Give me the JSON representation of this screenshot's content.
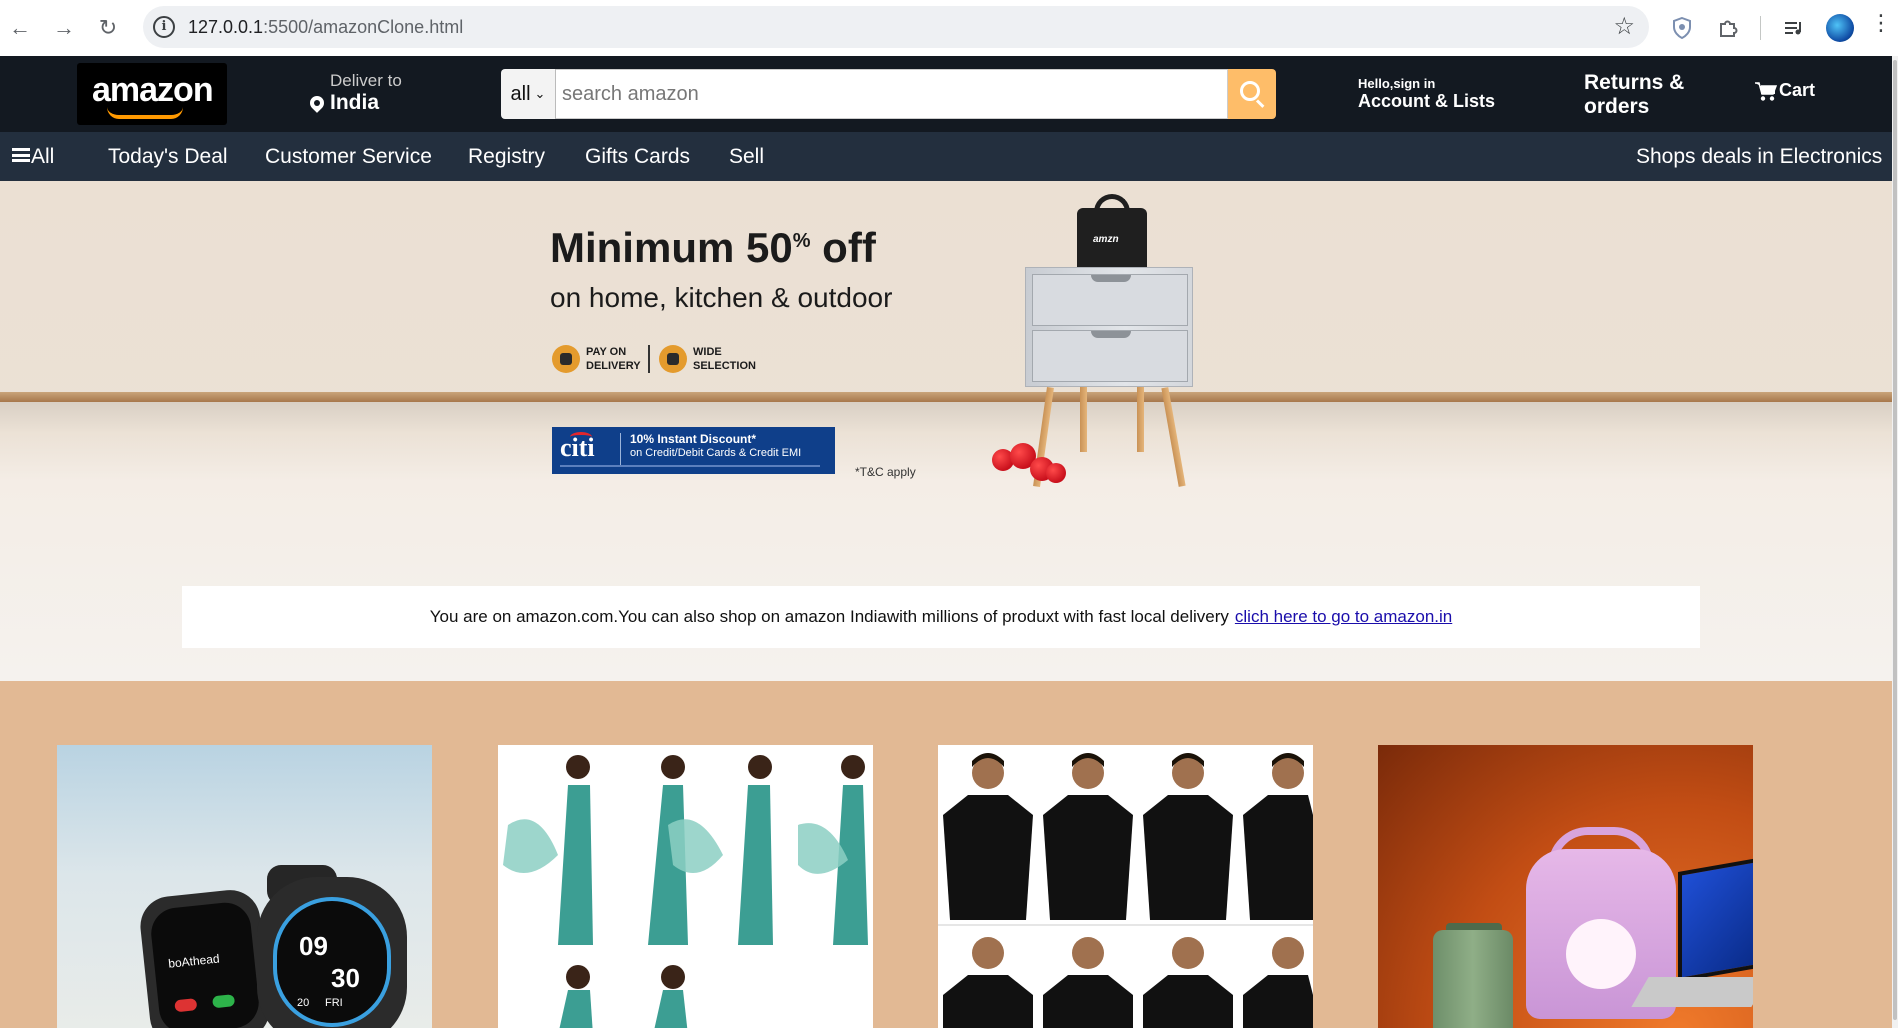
{
  "browser": {
    "url_host": "127.0.0.1",
    "url_rest": ":5500/amazonClone.html",
    "icons": [
      "back-icon",
      "forward-icon",
      "reload-icon",
      "site-info-icon",
      "bookmark-star-icon",
      "shield-extension-icon",
      "extensions-puzzle-icon",
      "media-control-icon",
      "profile-avatar-icon",
      "more-menu-icon"
    ]
  },
  "header": {
    "logo_text": "amazon",
    "deliver_label": "Deliver to",
    "deliver_location": "India",
    "search_category": "all",
    "search_placeholder": "search amazon",
    "account_hello": "Hello,sign in",
    "account_lists": "Account & Lists",
    "returns_line1": "Returns &",
    "returns_line2": "orders",
    "cart_label": "Cart",
    "colors": {
      "nav_bg": "#131921",
      "subnav_bg": "#232f3e",
      "search_button": "#febd69"
    }
  },
  "subnav": {
    "all_label": "All",
    "items": [
      "Today's Deal",
      "Customer Service",
      "Registry",
      "Gifts Cards",
      "Sell"
    ],
    "right_label": "Shops deals in Electronics"
  },
  "hero": {
    "title": "Minimum 50",
    "title_sup": "%",
    "title_suffix": " off",
    "subtitle": "on home, kitchen & outdoor",
    "badge1_line1": "PAY ON",
    "badge1_line2": "DELIVERY",
    "badge2_line1": "WIDE",
    "badge2_line2": "SELECTION",
    "citi_logo": "citi",
    "citi_line1": "10% Instant Discount*",
    "citi_line2": "on Credit/Debit Cards & Credit EMI",
    "tc": "*T&C apply",
    "bag_logo": "amzn"
  },
  "notice": {
    "text": "You are on amazon.com.You can also shop on amazon Indiawith millions of produxt with fast local delivery",
    "link": "clich here to go to amazon.in"
  },
  "products": {
    "watch_brand": "boAthead",
    "watch_time_h": "09",
    "watch_time_m": "30",
    "watch_day": "20",
    "watch_dow": "FRI"
  }
}
